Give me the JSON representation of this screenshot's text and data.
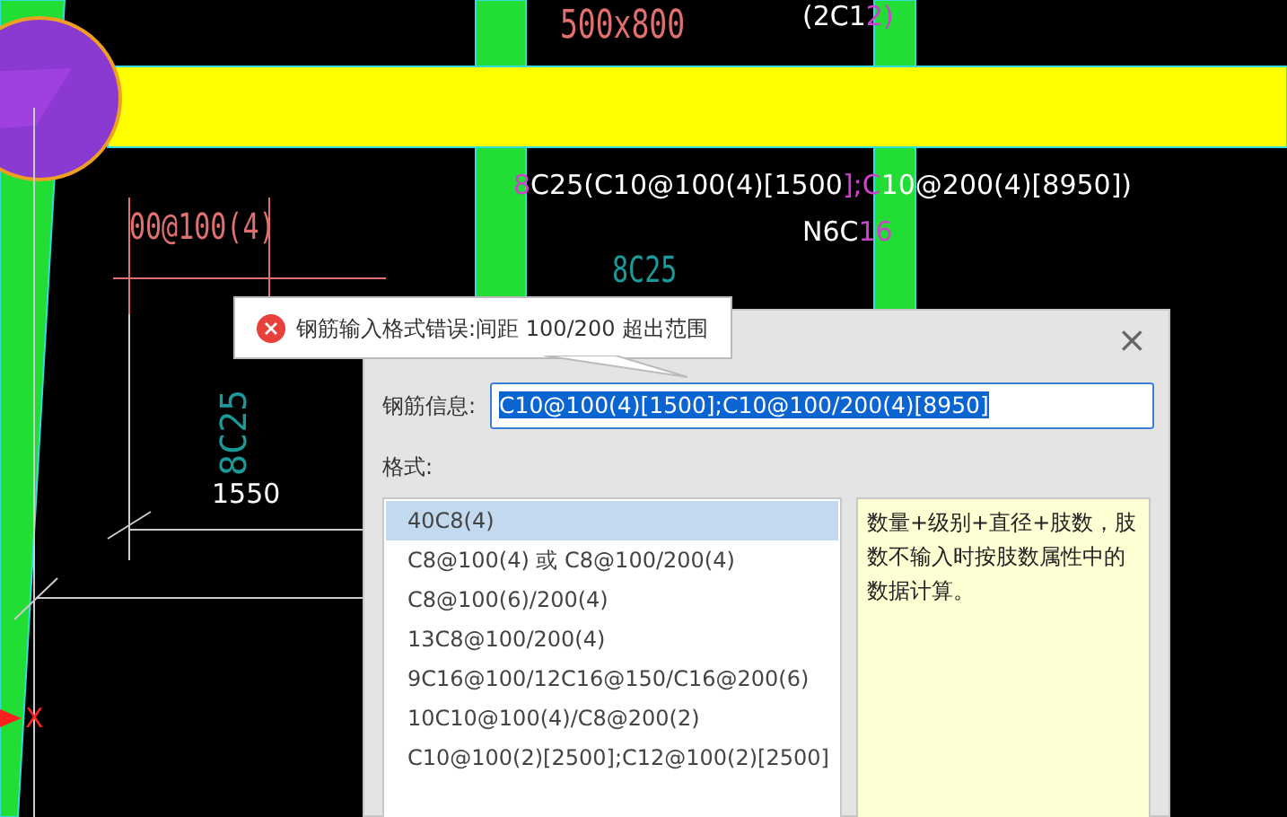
{
  "canvas_labels": [
    {
      "kind": "dim",
      "parts": [
        {
          "text": "500x800",
          "color": "#e07070"
        }
      ]
    },
    {
      "kind": "plain",
      "parts": [
        {
          "text": "(2C1",
          "color": "#ffffff"
        },
        {
          "text": "2)",
          "color": "#d040d0"
        }
      ]
    },
    {
      "kind": "plain",
      "parts": [
        {
          "text": "8",
          "color": "#d040d0"
        },
        {
          "text": "C25(C10@100(4)[1500",
          "color": "#ffffff"
        },
        {
          "text": "];C",
          "color": "#d040d0"
        },
        {
          "text": "10@200(4)[8950])",
          "color": "#ffffff"
        }
      ]
    },
    {
      "kind": "plain",
      "parts": [
        {
          "text": "N6C",
          "color": "#ffffff"
        },
        {
          "text": "16",
          "color": "#d040d0"
        }
      ]
    },
    {
      "kind": "dim",
      "parts": [
        {
          "text": "00@100(4)",
          "color": "#e07070"
        }
      ]
    },
    {
      "kind": "faint",
      "parts": [
        {
          "text": "8C25",
          "color": "#1a9a9a"
        }
      ]
    },
    {
      "kind": "vertical",
      "parts": [
        {
          "text": "8C25",
          "color": "#1a9a9a"
        }
      ]
    },
    {
      "kind": "plain",
      "parts": [
        {
          "text": "1550",
          "color": "#ffffff"
        }
      ]
    },
    {
      "kind": "axis",
      "parts": [
        {
          "text": "X",
          "color": "#ff2020"
        }
      ]
    }
  ],
  "tooltip": {
    "kind": "error",
    "message": "钢筋输入格式错误:间距 100/200 超出范围"
  },
  "dialog": {
    "close": "×",
    "rebar_label": "钢筋信息:",
    "rebar_value": "C10@100(4)[1500];C10@100/200(4)[8950]",
    "text_selected": true,
    "format_label": "格式:",
    "formats": [
      {
        "text": "40C8(4)",
        "selected": true
      },
      {
        "text": "C8@100(4) 或 C8@100/200(4)",
        "selected": false
      },
      {
        "text": "C8@100(6)/200(4)",
        "selected": false
      },
      {
        "text": "13C8@100/200(4)",
        "selected": false
      },
      {
        "text": "9C16@100/12C16@150/C16@200(6)",
        "selected": false
      },
      {
        "text": "10C10@100(4)/C8@200(2)",
        "selected": false
      },
      {
        "text": "C10@100(2)[2500];C12@100(2)[2500]",
        "selected": false
      }
    ],
    "description": "数量+级别+直径+肢数，肢数不输入时按肢数属性中的数据计算。"
  }
}
